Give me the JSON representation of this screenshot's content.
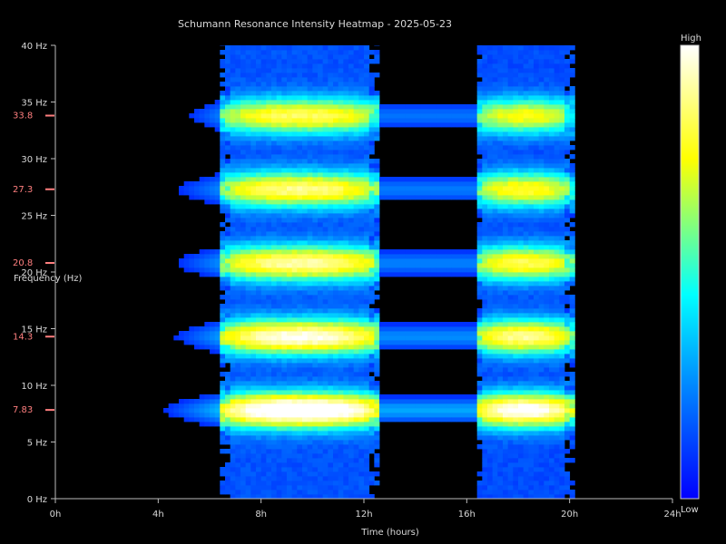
{
  "chart_data": {
    "type": "heatmap",
    "title": "Schumann Resonance Intensity Heatmap - 2025-05-23",
    "xlabel": "Time (hours)",
    "ylabel": "Frequency (Hz)",
    "xlim": [
      0,
      24
    ],
    "ylim": [
      0,
      40
    ],
    "x_ticks": [
      {
        "value": 0,
        "label": "0h"
      },
      {
        "value": 4,
        "label": "4h"
      },
      {
        "value": 8,
        "label": "8h"
      },
      {
        "value": 12,
        "label": "12h"
      },
      {
        "value": 16,
        "label": "16h"
      },
      {
        "value": 20,
        "label": "20h"
      },
      {
        "value": 24,
        "label": "24h"
      }
    ],
    "y_ticks": [
      {
        "value": 0,
        "label": "0 Hz"
      },
      {
        "value": 5,
        "label": "5 Hz"
      },
      {
        "value": 10,
        "label": "10 Hz"
      },
      {
        "value": 15,
        "label": "15 Hz"
      },
      {
        "value": 20,
        "label": "20 Hz"
      },
      {
        "value": 25,
        "label": "25 Hz"
      },
      {
        "value": 30,
        "label": "30 Hz"
      },
      {
        "value": 35,
        "label": "35 Hz"
      },
      {
        "value": 40,
        "label": "40 Hz"
      }
    ],
    "resonance_markers": [
      {
        "value": 7.83,
        "label": "7.83"
      },
      {
        "value": 14.3,
        "label": "14.3"
      },
      {
        "value": 20.8,
        "label": "20.8"
      },
      {
        "value": 27.3,
        "label": "27.3"
      },
      {
        "value": 33.8,
        "label": "33.8"
      }
    ],
    "marker_color": "#ff7f7f",
    "colorbar": {
      "high_label": "High",
      "low_label": "Low"
    },
    "colormap": [
      "#0000ff",
      "#0088ff",
      "#00ffff",
      "#ffff00",
      "#ffffff"
    ],
    "bands": [
      {
        "center": 7.83,
        "peak": 1.0,
        "start": 3.6,
        "end": 20.2
      },
      {
        "center": 14.3,
        "peak": 0.85,
        "start": 4.0,
        "end": 20.2
      },
      {
        "center": 20.8,
        "peak": 0.78,
        "start": 4.0,
        "end": 20.2
      },
      {
        "center": 27.3,
        "peak": 0.74,
        "start": 4.0,
        "end": 20.2
      },
      {
        "center": 33.8,
        "peak": 0.7,
        "start": 4.6,
        "end": 20.2
      }
    ],
    "activity_windows": [
      {
        "start": 6.5,
        "end": 12.6,
        "intensity": 1.0
      },
      {
        "start": 16.3,
        "end": 20.2,
        "intensity": 0.9
      }
    ],
    "bridge_window": {
      "start": 12.6,
      "end": 16.3,
      "intensity": 0.55
    },
    "grid": false
  }
}
